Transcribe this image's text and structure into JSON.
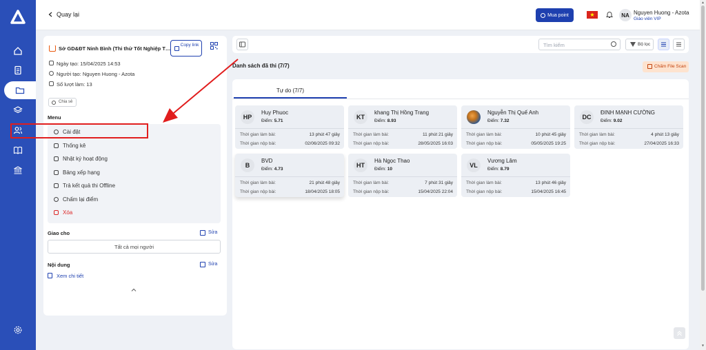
{
  "topbar": {
    "back_label": "Quay lại",
    "buy_points_label": "Mua point",
    "user_initials": "NA",
    "user_name": "Nguyen Huong - Azota",
    "user_role": "Giáo viên VIP"
  },
  "exam": {
    "title": "Sở GD&ĐT Ninh Bình (Thi thử Tốt Nghiệp THPT ...",
    "copy_link_label": "Copy link",
    "created_date": "Ngày tạo: 15/04/2025 14:53",
    "creator": "Người tạo: Nguyen Huong - Azota",
    "attempt_count": "Số lượt làm: 13",
    "share_label": "Chia sẻ"
  },
  "menu": {
    "title": "Menu",
    "items": [
      {
        "label": "Cài đặt",
        "icon": "gear-icon"
      },
      {
        "label": "Thống kê",
        "icon": "chart-icon"
      },
      {
        "label": "Nhật ký hoạt động",
        "icon": "activity-icon"
      },
      {
        "label": "Bảng xếp hạng",
        "icon": "ranking-icon"
      },
      {
        "label": "Trả kết quả thi Offline",
        "icon": "return-icon"
      },
      {
        "label": "Chấm lại điểm",
        "icon": "refresh-icon"
      },
      {
        "label": "Xóa",
        "icon": "trash-icon",
        "color": "#dc2626"
      }
    ]
  },
  "assign": {
    "title": "Giao cho",
    "edit_label": "Sửa",
    "value": "Tất cả mọi người"
  },
  "content": {
    "title": "Nội dung",
    "edit_label": "Sửa",
    "detail_label": "Xem chi tiết"
  },
  "toolbar": {
    "search_placeholder": "Tìm kiếm",
    "filter_label": "Bộ lọc"
  },
  "list": {
    "title": "Danh sách đã thi (7/7)",
    "scan_label": "Chấm File Scan",
    "tab_label": "Tự do (7/7)",
    "duration_label": "Thời gian làm bài:",
    "submit_label": "Thời gian nộp bài:",
    "score_prefix": "Điểm:"
  },
  "students": [
    {
      "initials": "HP",
      "name": "Huy Phuoc",
      "score": "5.71",
      "duration": "13 phút 47 giây",
      "submitted": "02/06/2025 09:32"
    },
    {
      "initials": "KT",
      "name": "khang Thị Hồng Trang",
      "score": "8.93",
      "duration": "11 phút 21 giây",
      "submitted": "28/05/2025 16:03"
    },
    {
      "initials": "",
      "name": "Nguyễn Thị Quế Anh",
      "score": "7.32",
      "duration": "10 phút 45 giây",
      "submitted": "05/05/2025 19:25"
    },
    {
      "initials": "DC",
      "name": "ĐINH MẠNH CƯỜNG",
      "score": "9.02",
      "duration": "4 phút 13 giây",
      "submitted": "27/04/2025 16:33"
    },
    {
      "initials": "B",
      "name": "BVD",
      "score": "4.73",
      "duration": "21 phút 48 giây",
      "submitted": "18/04/2025 18:05"
    },
    {
      "initials": "HT",
      "name": "Hà Ngọc Thao",
      "score": "10",
      "duration": "7 phút 31 giây",
      "submitted": "15/04/2025 22:04"
    },
    {
      "initials": "VL",
      "name": "Vương Lâm",
      "score": "8.79",
      "duration": "13 phút 46 giây",
      "submitted": "15/04/2025 16:45"
    }
  ],
  "colors": {
    "sidebar": "#2a4fb8",
    "accent": "#1e40af",
    "highlight": "#e11d1d",
    "danger": "#dc2626",
    "scan_bg": "#fde3cf"
  }
}
